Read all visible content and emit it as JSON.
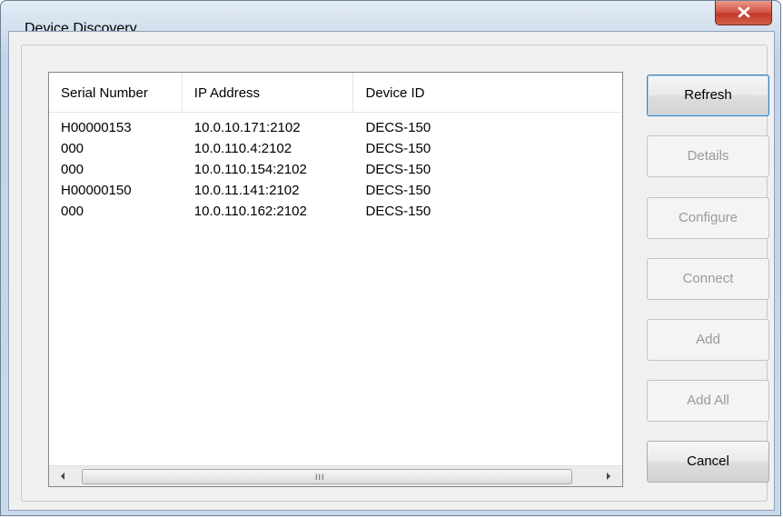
{
  "window": {
    "title": "Device Discovery"
  },
  "list": {
    "columns": [
      "Serial Number",
      "IP Address",
      "Device ID"
    ],
    "rows": [
      [
        "H00000153",
        "10.0.10.171:2102",
        "DECS-150"
      ],
      [
        "000",
        "10.0.110.4:2102",
        "DECS-150"
      ],
      [
        "000",
        "10.0.110.154:2102",
        "DECS-150"
      ],
      [
        "H00000150",
        "10.0.11.141:2102",
        "DECS-150"
      ],
      [
        "000",
        "10.0.110.162:2102",
        "DECS-150"
      ]
    ],
    "scrollbar_grip": "III"
  },
  "buttons": {
    "refresh": "Refresh",
    "details": "Details",
    "configure": "Configure",
    "connect": "Connect",
    "add": "Add",
    "add_all": "Add All",
    "cancel": "Cancel"
  }
}
